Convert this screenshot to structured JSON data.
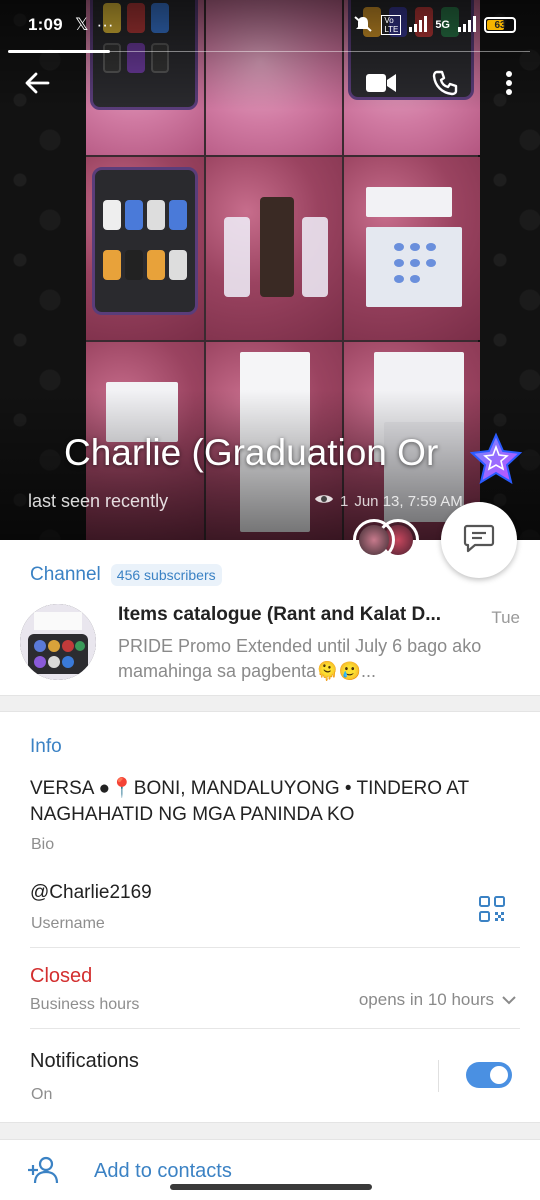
{
  "status_bar": {
    "time": "1:09",
    "left_icons": [
      "x-logo-icon",
      "more-dots-icon"
    ],
    "network": "5G",
    "volte": "Vo LTE",
    "battery_level": "63",
    "battery_color": "#f5b400"
  },
  "profile": {
    "name": "Charlie (Graduation Or",
    "last_seen": "last seen recently",
    "story_views": "1",
    "story_time": "Jun 13, 7:59 AM"
  },
  "channel": {
    "label": "Channel",
    "subscribers": "456 subscribers",
    "name": "Items catalogue (Rant and Kalat D...",
    "day": "Tue",
    "preview": "PRIDE Promo Extended until July 6 bago ako mamahinga sa pagbenta🫠🥲..."
  },
  "info": {
    "title": "Info",
    "bio": "VERSA ●📍BONI, MANDALUYONG • TINDERO AT NAGHAHATID NG MGA PANINDA KO",
    "bio_label": "Bio",
    "username": "@Charlie2169",
    "username_label": "Username",
    "business_status": "Closed",
    "business_label": "Business hours",
    "opens": "opens in 10 hours",
    "notifications": "Notifications",
    "notifications_state": "On",
    "notifications_enabled": true
  },
  "contacts": {
    "add_label": "Add to contacts"
  },
  "colors": {
    "accent": "#3b82c4",
    "closed": "#d32f2f",
    "toggle": "#4a90e2"
  }
}
